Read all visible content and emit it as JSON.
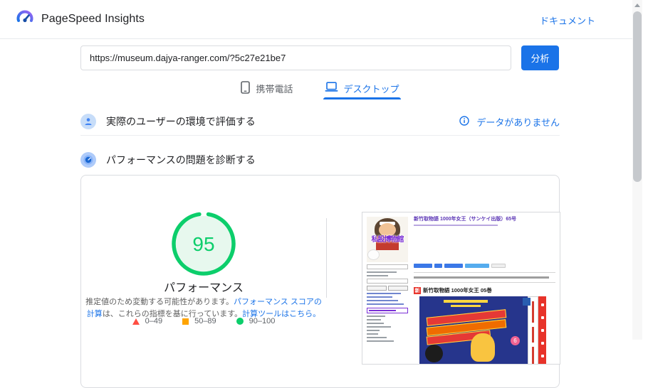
{
  "header": {
    "app_title": "PageSpeed Insights",
    "doc_link": "ドキュメント"
  },
  "analyze": {
    "url_value": "https://museum.dajya-ranger.com/?5c27e21be7",
    "analyze_button": "分析"
  },
  "tabs": {
    "mobile_label": "携帯電話",
    "desktop_label": "デスクトップ"
  },
  "sections": {
    "field_data_title": "実際のユーザーの環境で評価する",
    "no_data_label": "データがありません",
    "diagnose_title": "パフォーマンスの問題を診断する"
  },
  "performance": {
    "score": "95",
    "label": "パフォーマンス",
    "desc_text_1": "推定値のため変動する可能性があります。",
    "desc_link_1": "パフォーマンス スコアの計算",
    "desc_text_2": "は、これらの指標を基に行っています。",
    "desc_link_2": "計算ツールはこちら。",
    "legend": [
      {
        "shape": "triangle",
        "color": "#ff4e42",
        "range": "0–49"
      },
      {
        "shape": "square",
        "color": "#ffa400",
        "range": "50–89"
      },
      {
        "shape": "circle",
        "color": "#0cce6b",
        "range": "90–100"
      }
    ]
  },
  "thumbnail": {
    "site_logo_text": "私設博物館",
    "post_title": "新竹取物語 1000年女王（サンケイ出版）65号",
    "new_badge": "新",
    "section_heading": "新竹取物語 1000年女王 05巻"
  },
  "colors": {
    "accent_blue": "#1a73e8",
    "score_green": "#0cce6b",
    "legend_red": "#ff4e42",
    "legend_orange": "#ffa400",
    "border_gray": "#dadce0"
  }
}
